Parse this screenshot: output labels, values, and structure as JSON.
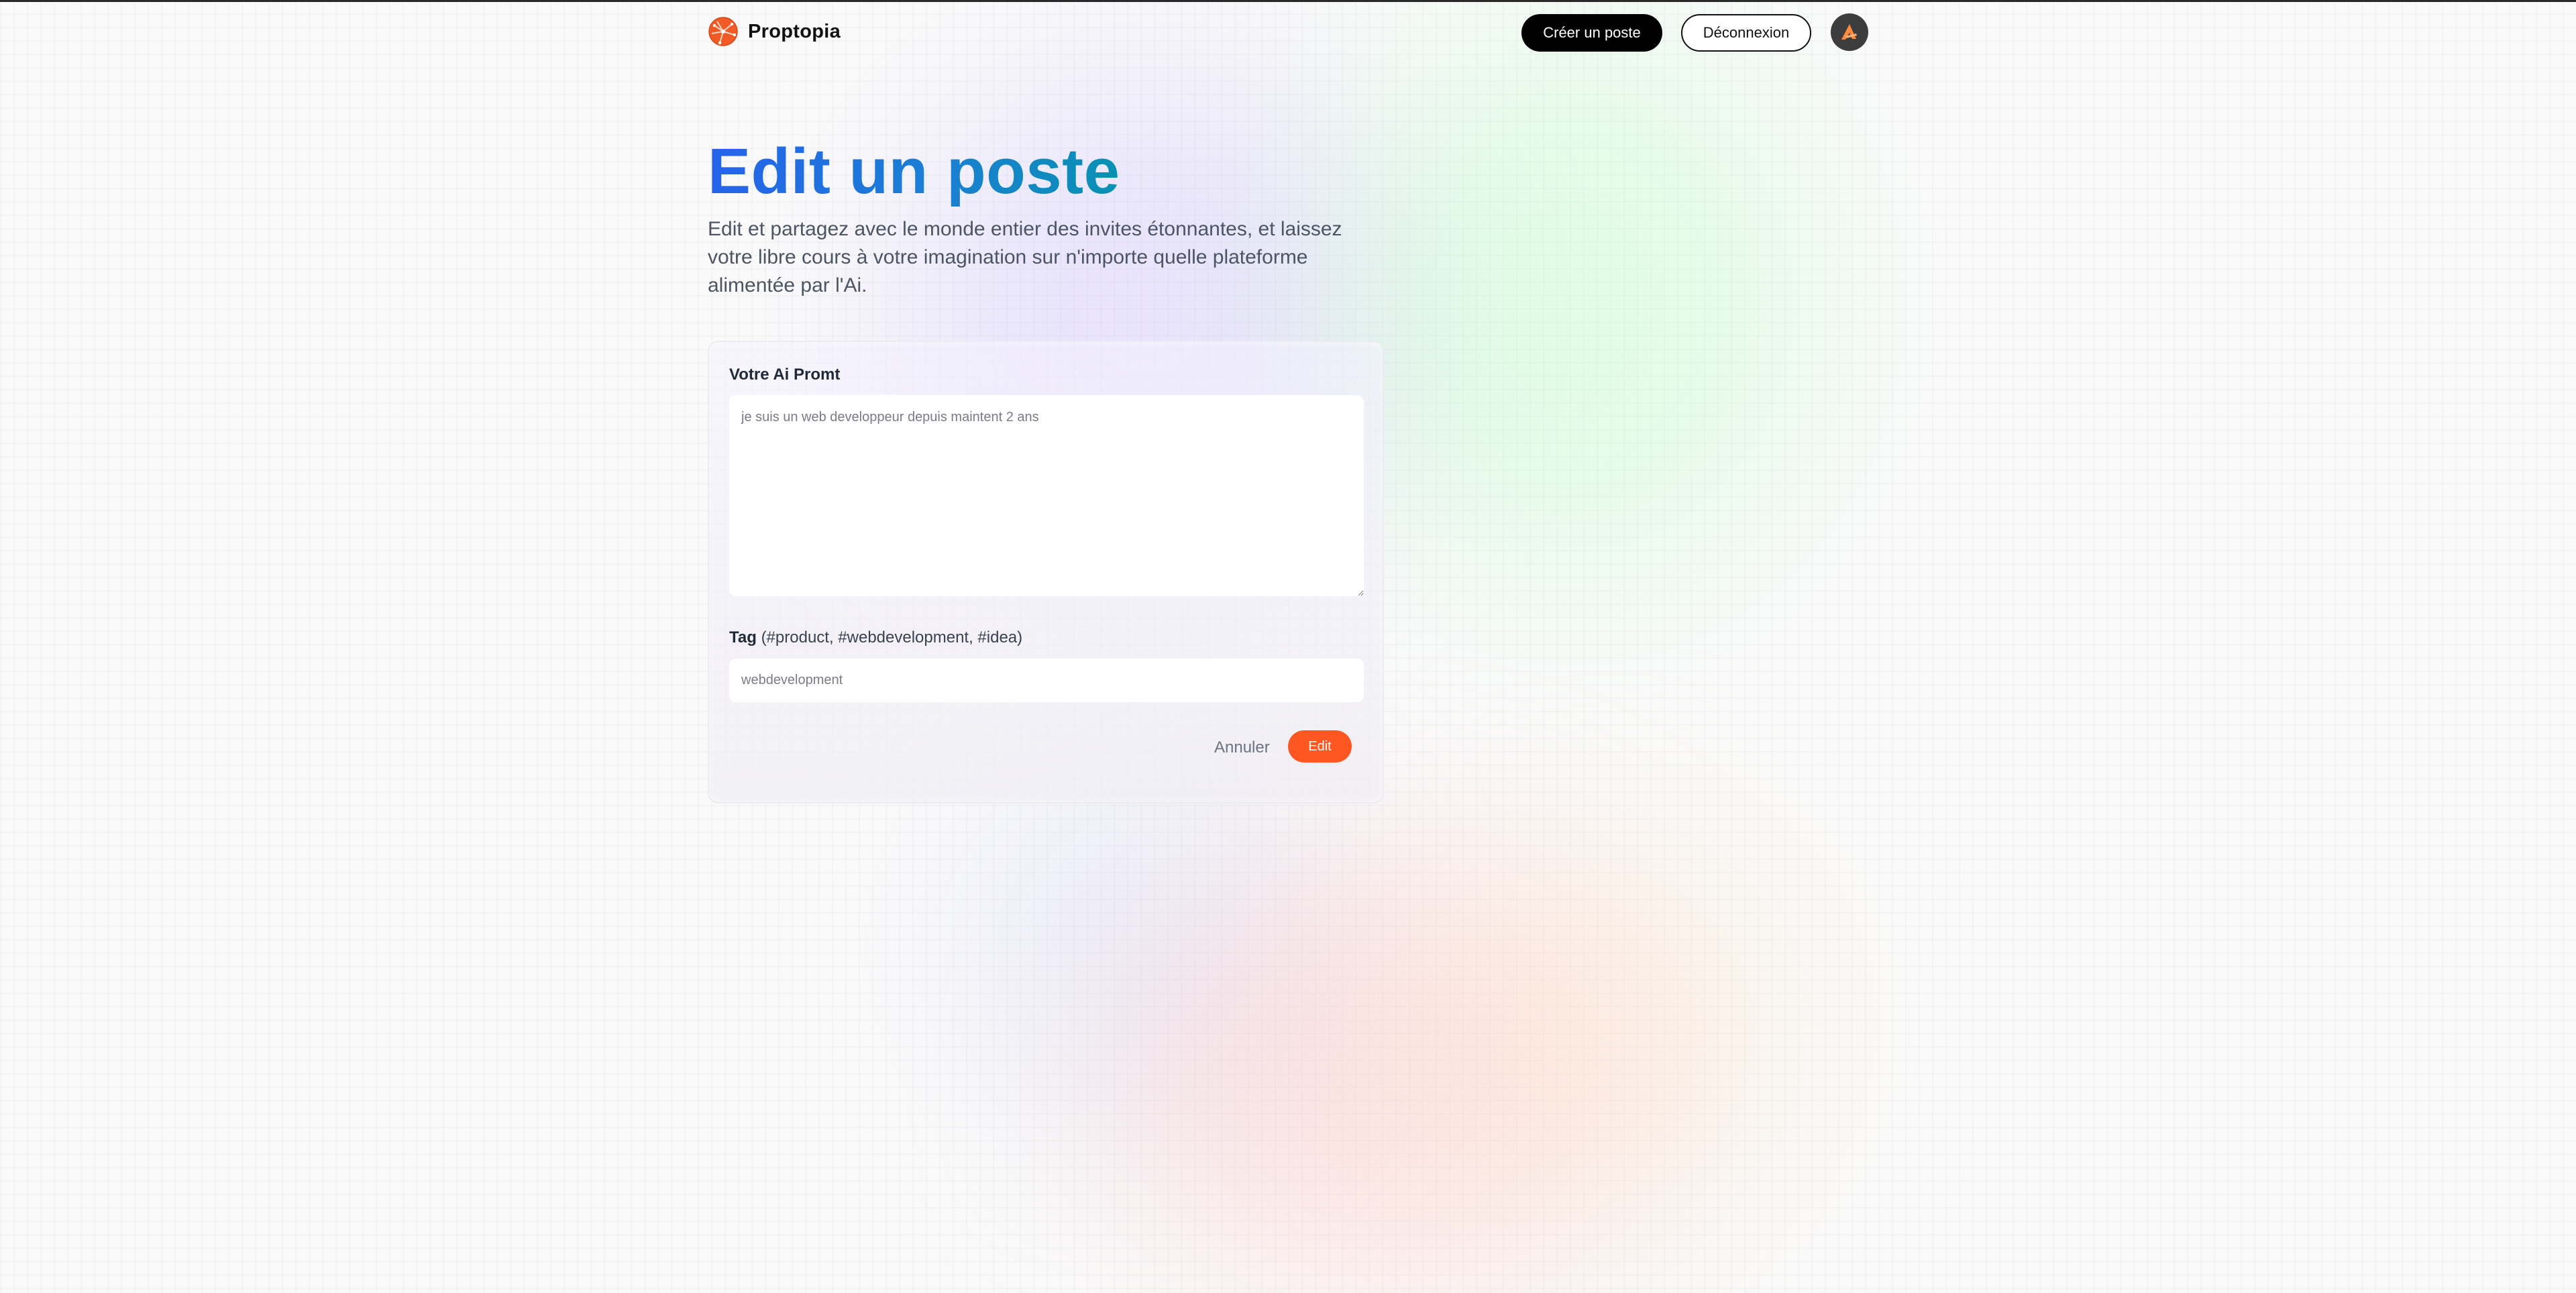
{
  "header": {
    "brand_name": "Proptopia",
    "create_post_label": "Créer un poste",
    "logout_label": "Déconnexion"
  },
  "hero": {
    "title": "Edit un poste",
    "description": "Edit et partagez avec le monde entier des invites étonnantes, et laissez votre libre cours à votre imagination sur n'importe quelle plateforme alimentée par l'Ai."
  },
  "form": {
    "prompt_label": "Votre Ai Promt",
    "prompt_placeholder": "je suis un web developpeur depuis maintent 2 ans",
    "tag_label": "Tag",
    "tag_hint": "(#product, #webdevelopment, #idea)",
    "tag_placeholder": "webdevelopment",
    "cancel_label": "Annuler",
    "submit_label": "Edit"
  },
  "colors": {
    "accent": "#ff5722",
    "title_gradient_start": "#2563eb",
    "title_gradient_end": "#0891b2"
  },
  "icons": {
    "brand": "logo-icon",
    "avatar": "avatar-icon"
  }
}
